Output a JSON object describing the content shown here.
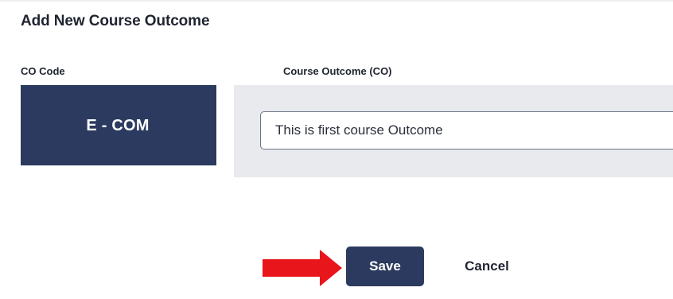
{
  "dialog": {
    "title": "Add New Course Outcome"
  },
  "form": {
    "co_code_label": "CO Code",
    "co_code_value": "E - COM",
    "course_outcome_label": "Course Outcome (CO)",
    "course_outcome_value": "This is first course Outcome"
  },
  "actions": {
    "save_label": "Save",
    "cancel_label": "Cancel"
  },
  "colors": {
    "primary": "#2b3a5e",
    "panel": "#e8eaee",
    "annotation_arrow": "#e8151b"
  },
  "icons": {
    "annotation": "right-arrow-icon"
  }
}
